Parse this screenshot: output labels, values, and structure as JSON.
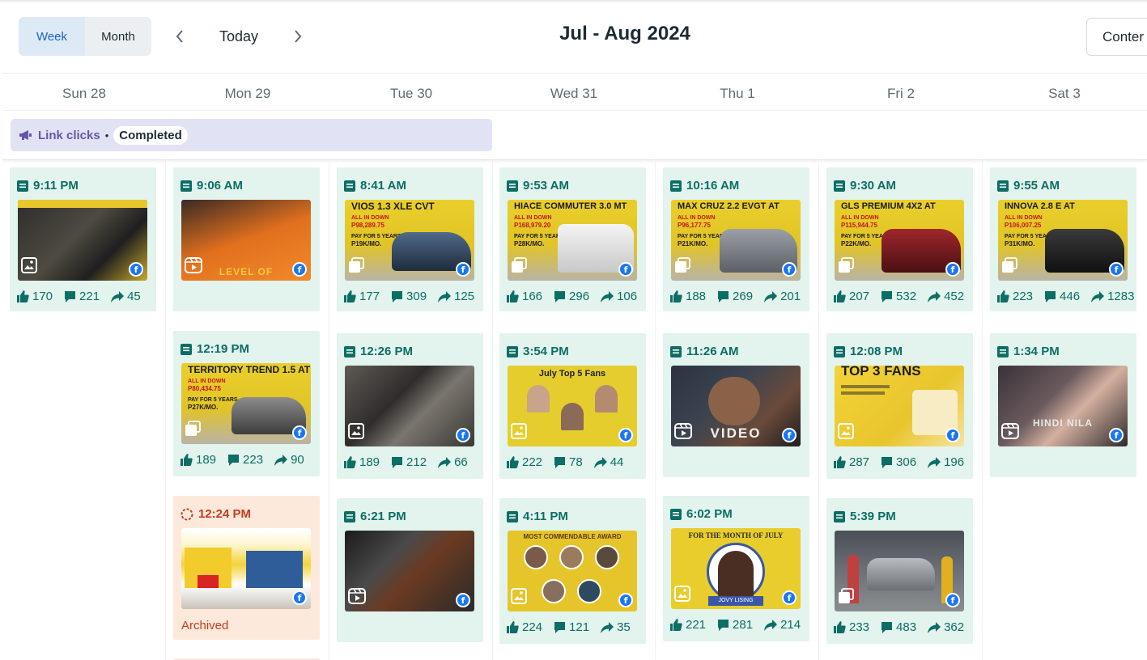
{
  "toolbar": {
    "week_label": "Week",
    "month_label": "Month",
    "today_label": "Today",
    "range_title": "Jul - Aug 2024",
    "content_label": "Conter"
  },
  "days": [
    "Sun 28",
    "Mon 29",
    "Tue 30",
    "Wed 31",
    "Thu 1",
    "Fri 2",
    "Sat 3"
  ],
  "all_day_event": {
    "label": "Link clicks",
    "separator": "•",
    "status": "Completed"
  },
  "posts": {
    "sun": [
      {
        "time": "9:11 PM",
        "likes": "170",
        "comments": "221",
        "shares": "45"
      }
    ],
    "mon": [
      {
        "time": "9:06 AM",
        "thumb_text": "LEVEL OF"
      },
      {
        "time": "12:19 PM",
        "thumb_text": "TERRITORY TREND 1.5 AT",
        "price_label": "ALL IN DOWN",
        "price": "P80,434.75",
        "monthly_label": "PAY FOR 5 YEARS",
        "monthly": "P27K/MO.",
        "likes": "189",
        "comments": "223",
        "shares": "90"
      },
      {
        "time": "12:24 PM",
        "status": "Archived"
      }
    ],
    "tue": [
      {
        "time": "8:41 AM",
        "thumb_text": "VIOS 1.3 XLE CVT",
        "price_label": "ALL IN DOWN",
        "price": "P98,289.75",
        "monthly_label": "PAY FOR 5 YEARS",
        "monthly": "P19K/MO.",
        "likes": "177",
        "comments": "309",
        "shares": "125"
      },
      {
        "time": "12:26 PM",
        "likes": "189",
        "comments": "212",
        "shares": "66"
      },
      {
        "time": "6:21 PM"
      }
    ],
    "wed": [
      {
        "time": "9:53 AM",
        "thumb_text": "HIACE COMMUTER 3.0 MT",
        "price_label": "ALL IN DOWN",
        "price": "P168,979.20",
        "monthly_label": "PAY FOR 5 YEARS",
        "monthly": "P28K/MO.",
        "likes": "166",
        "comments": "296",
        "shares": "106"
      },
      {
        "time": "3:54 PM",
        "thumb_text": "July Top 5 Fans",
        "likes": "222",
        "comments": "78",
        "shares": "44"
      },
      {
        "time": "4:11 PM",
        "thumb_text": "MOST COMMENDABLE AWARD",
        "likes": "224",
        "comments": "121",
        "shares": "35"
      }
    ],
    "thu": [
      {
        "time": "10:16 AM",
        "thumb_text": "MAX CRUZ 2.2 EVGT AT",
        "price_label": "ALL IN DOWN",
        "price": "P96,177.75",
        "monthly_label": "PAY FOR 5 YEARS",
        "monthly": "P21K/MO.",
        "likes": "188",
        "comments": "269",
        "shares": "201"
      },
      {
        "time": "11:26 AM",
        "thumb_text": "VIDEO"
      },
      {
        "time": "6:02 PM",
        "thumb_text": "FOR THE MONTH OF JULY",
        "thumb_name": "JOVY LISING",
        "likes": "221",
        "comments": "281",
        "shares": "214"
      }
    ],
    "fri": [
      {
        "time": "9:30 AM",
        "thumb_text": "GLS PREMIUM 4X2 AT",
        "price_label": "ALL IN DOWN",
        "price": "P115,944.75",
        "monthly_label": "PAY FOR 5 YEARS",
        "monthly": "P22K/MO.",
        "likes": "207",
        "comments": "532",
        "shares": "452"
      },
      {
        "time": "12:08 PM",
        "thumb_text": "TOP 3 FANS",
        "likes": "287",
        "comments": "306",
        "shares": "196"
      },
      {
        "time": "5:39 PM",
        "likes": "233",
        "comments": "483",
        "shares": "362"
      }
    ],
    "sat": [
      {
        "time": "9:55 AM",
        "thumb_text": "INNOVA 2.8 E AT",
        "price_label": "ALL IN DOWN",
        "price": "P106,007.25",
        "monthly_label": "PAY FOR 5 YEARS",
        "monthly": "P31K/MO.",
        "likes": "223",
        "comments": "446",
        "shares": "1283"
      },
      {
        "time": "1:34 PM",
        "thumb_text": "HINDI NILA"
      }
    ]
  },
  "colors": {
    "published_bg": "#e3f3ee",
    "published_text": "#0c6e64",
    "archived_bg": "#fde9db",
    "archived_text": "#c63c1c",
    "link_bar_bg": "#e1e3f5",
    "link_bar_text": "#6557a6",
    "facebook": "#1877f2"
  },
  "icons": {
    "post_type": "post-icon",
    "archived": "archived-status-icon",
    "like": "like-icon",
    "comment": "comment-icon",
    "share": "share-icon",
    "facebook": "facebook-icon",
    "image": "image-icon",
    "reel": "reel-icon",
    "carousel": "carousel-icon",
    "megaphone": "megaphone-icon"
  }
}
